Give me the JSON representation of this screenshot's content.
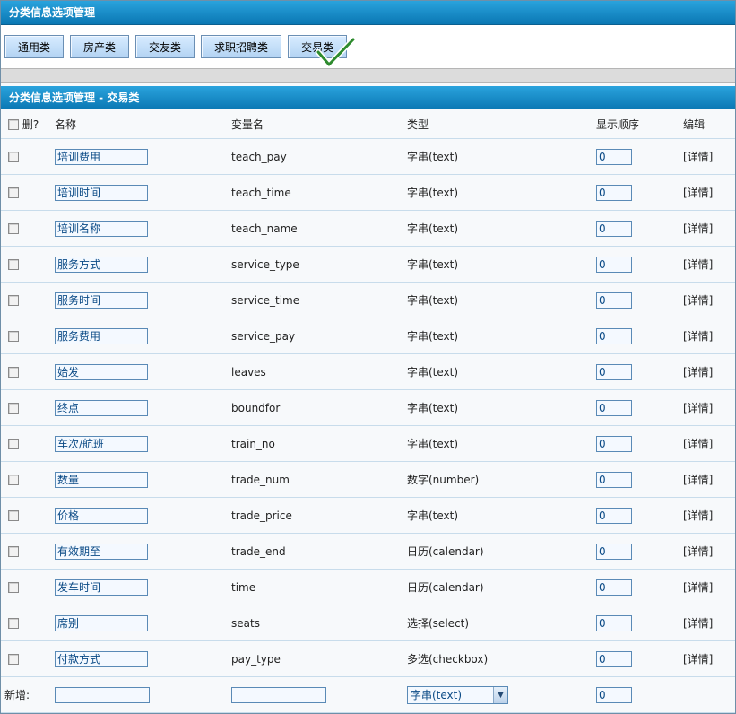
{
  "header": {
    "title": "分类信息选项管理"
  },
  "tabs": [
    {
      "label": "通用类",
      "active": false
    },
    {
      "label": "房产类",
      "active": false
    },
    {
      "label": "交友类",
      "active": false
    },
    {
      "label": "求职招聘类",
      "active": false
    },
    {
      "label": "交易类",
      "active": true
    }
  ],
  "section": {
    "title": "分类信息选项管理  - 交易类"
  },
  "columns": {
    "delete": "删?",
    "name": "名称",
    "varname": "变量名",
    "type": "类型",
    "order": "显示顺序",
    "edit": "编辑"
  },
  "rows": [
    {
      "name": "培训费用",
      "var": "teach_pay",
      "type": "字串(text)",
      "order": "0",
      "edit": "[详情]"
    },
    {
      "name": "培训时间",
      "var": "teach_time",
      "type": "字串(text)",
      "order": "0",
      "edit": "[详情]"
    },
    {
      "name": "培训名称",
      "var": "teach_name",
      "type": "字串(text)",
      "order": "0",
      "edit": "[详情]"
    },
    {
      "name": "服务方式",
      "var": "service_type",
      "type": "字串(text)",
      "order": "0",
      "edit": "[详情]"
    },
    {
      "name": "服务时间",
      "var": "service_time",
      "type": "字串(text)",
      "order": "0",
      "edit": "[详情]"
    },
    {
      "name": "服务费用",
      "var": "service_pay",
      "type": "字串(text)",
      "order": "0",
      "edit": "[详情]"
    },
    {
      "name": "始发",
      "var": "leaves",
      "type": "字串(text)",
      "order": "0",
      "edit": "[详情]"
    },
    {
      "name": "终点",
      "var": "boundfor",
      "type": "字串(text)",
      "order": "0",
      "edit": "[详情]"
    },
    {
      "name": "车次/航班",
      "var": "train_no",
      "type": "字串(text)",
      "order": "0",
      "edit": "[详情]"
    },
    {
      "name": "数量",
      "var": "trade_num",
      "type": "数字(number)",
      "order": "0",
      "edit": "[详情]"
    },
    {
      "name": "价格",
      "var": "trade_price",
      "type": "字串(text)",
      "order": "0",
      "edit": "[详情]"
    },
    {
      "name": "有效期至",
      "var": "trade_end",
      "type": "日历(calendar)",
      "order": "0",
      "edit": "[详情]"
    },
    {
      "name": "发车时间",
      "var": "time",
      "type": "日历(calendar)",
      "order": "0",
      "edit": "[详情]"
    },
    {
      "name": "席别",
      "var": "seats",
      "type": "选择(select)",
      "order": "0",
      "edit": "[详情]"
    },
    {
      "name": "付款方式",
      "var": "pay_type",
      "type": "多选(checkbox)",
      "order": "0",
      "edit": "[详情]"
    }
  ],
  "new_row": {
    "label": "新增:",
    "name_value": "",
    "var_value": "",
    "type_selected": "字串(text)",
    "order_value": "0"
  },
  "icons": {
    "active_tab_mark": "checkmark-icon",
    "select_arrow": "chevron-down-icon"
  },
  "colors": {
    "header_bar": "#0a77b3",
    "accent": "#2aa3dd",
    "tab_fill": "#b3d3f3"
  }
}
